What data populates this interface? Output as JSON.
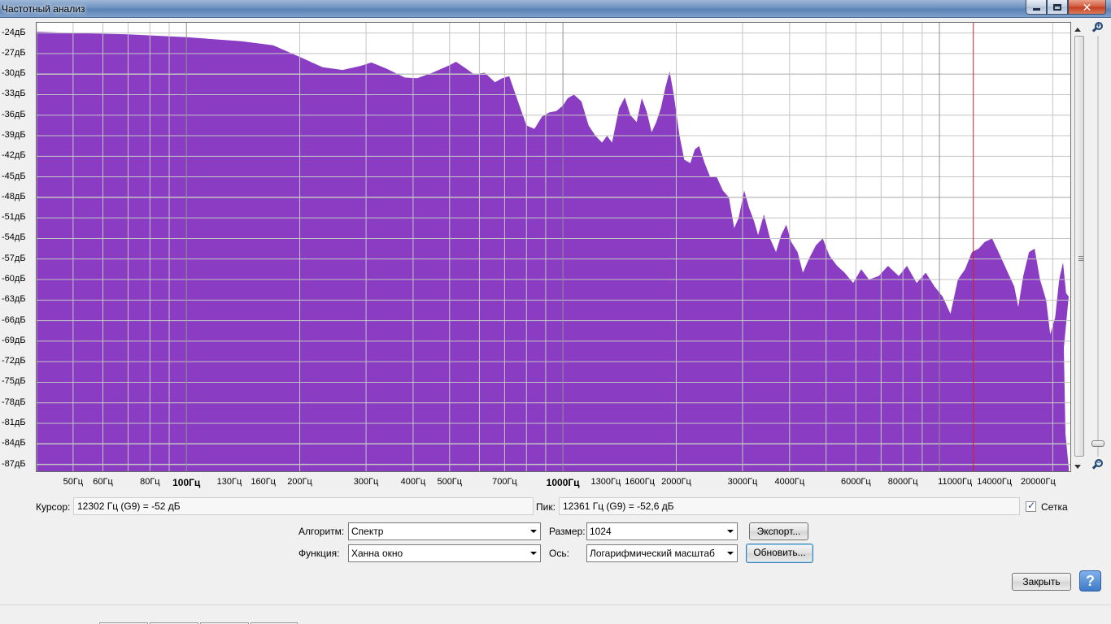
{
  "window": {
    "title": "Частотный анализ"
  },
  "plot": {
    "y_axis_labels": [
      "-24дБ",
      "-27дБ",
      "-30дБ",
      "-33дБ",
      "-36дБ",
      "-39дБ",
      "-42дБ",
      "-45дБ",
      "-48дБ",
      "-51дБ",
      "-54дБ",
      "-57дБ",
      "-60дБ",
      "-63дБ",
      "-66дБ",
      "-69дБ",
      "-72дБ",
      "-75дБ",
      "-78дБ",
      "-81дБ",
      "-84дБ",
      "-87дБ"
    ],
    "x_axis_labels": [
      {
        "text": "50Гц",
        "hz": 50
      },
      {
        "text": "60Гц",
        "hz": 60
      },
      {
        "text": "80Гц",
        "hz": 80
      },
      {
        "text": "100Гц",
        "hz": 100,
        "major": true
      },
      {
        "text": "130Гц",
        "hz": 130
      },
      {
        "text": "160Гц",
        "hz": 160
      },
      {
        "text": "200Гц",
        "hz": 200
      },
      {
        "text": "300Гц",
        "hz": 300
      },
      {
        "text": "400Гц",
        "hz": 400
      },
      {
        "text": "500Гц",
        "hz": 500
      },
      {
        "text": "700Гц",
        "hz": 700
      },
      {
        "text": "1000Гц",
        "hz": 1000,
        "major": true
      },
      {
        "text": "1300Гц",
        "hz": 1300
      },
      {
        "text": "1600Гц",
        "hz": 1600
      },
      {
        "text": "2000Гц",
        "hz": 2000
      },
      {
        "text": "3000Гц",
        "hz": 3000
      },
      {
        "text": "4000Гц",
        "hz": 4000
      },
      {
        "text": "6000Гц",
        "hz": 6000
      },
      {
        "text": "8000Гц",
        "hz": 8000
      },
      {
        "text": "11000Гц",
        "hz": 11000
      },
      {
        "text": "14000Гц",
        "hz": 14000
      },
      {
        "text": "20000Гц",
        "hz": 20000
      }
    ],
    "fill_color": "#8a3cc2",
    "cursor_line_color": "#cc2222",
    "grid_color": "#c4c4c4",
    "cursor_hz": 12302,
    "grid": true,
    "x_scale": "log",
    "x_range_hz": [
      40,
      22050
    ],
    "y_range_db": [
      -88,
      -22.5
    ],
    "spectrum_points": [
      [
        40,
        -23.8
      ],
      [
        50,
        -24.0
      ],
      [
        70,
        -24.2
      ],
      [
        100,
        -24.6
      ],
      [
        140,
        -25.2
      ],
      [
        170,
        -25.8
      ],
      [
        200,
        -27.5
      ],
      [
        230,
        -29.0
      ],
      [
        260,
        -29.4
      ],
      [
        290,
        -28.8
      ],
      [
        310,
        -28.3
      ],
      [
        340,
        -29.2
      ],
      [
        380,
        -30.5
      ],
      [
        410,
        -30.6
      ],
      [
        450,
        -29.8
      ],
      [
        500,
        -28.7
      ],
      [
        520,
        -28.2
      ],
      [
        550,
        -29.1
      ],
      [
        580,
        -30.0
      ],
      [
        620,
        -29.8
      ],
      [
        660,
        -31.2
      ],
      [
        690,
        -30.6
      ],
      [
        720,
        -30.3
      ],
      [
        760,
        -34.0
      ],
      [
        800,
        -37.5
      ],
      [
        840,
        -38.0
      ],
      [
        880,
        -36.2
      ],
      [
        920,
        -35.6
      ],
      [
        960,
        -35.4
      ],
      [
        1000,
        -34.6
      ],
      [
        1030,
        -33.5
      ],
      [
        1070,
        -33.0
      ],
      [
        1120,
        -34.0
      ],
      [
        1170,
        -37.5
      ],
      [
        1220,
        -39.0
      ],
      [
        1270,
        -40.0
      ],
      [
        1310,
        -39.0
      ],
      [
        1350,
        -40.0
      ],
      [
        1410,
        -35.0
      ],
      [
        1460,
        -33.4
      ],
      [
        1510,
        -36.0
      ],
      [
        1570,
        -37.0
      ],
      [
        1620,
        -33.5
      ],
      [
        1670,
        -35.5
      ],
      [
        1720,
        -38.5
      ],
      [
        1770,
        -37.0
      ],
      [
        1820,
        -35.0
      ],
      [
        1870,
        -32.0
      ],
      [
        1920,
        -29.6
      ],
      [
        1970,
        -33.0
      ],
      [
        2040,
        -39.0
      ],
      [
        2100,
        -42.5
      ],
      [
        2180,
        -43.0
      ],
      [
        2240,
        -41.0
      ],
      [
        2300,
        -40.5
      ],
      [
        2380,
        -43.0
      ],
      [
        2460,
        -45.0
      ],
      [
        2560,
        -45.0
      ],
      [
        2660,
        -47.0
      ],
      [
        2760,
        -48.0
      ],
      [
        2850,
        -52.5
      ],
      [
        2930,
        -51.0
      ],
      [
        3030,
        -47.0
      ],
      [
        3120,
        -49.5
      ],
      [
        3220,
        -51.5
      ],
      [
        3300,
        -53.5
      ],
      [
        3420,
        -50.5
      ],
      [
        3550,
        -54.0
      ],
      [
        3680,
        -56.0
      ],
      [
        3800,
        -53.5
      ],
      [
        3920,
        -52.0
      ],
      [
        4040,
        -54.5
      ],
      [
        4200,
        -56.0
      ],
      [
        4340,
        -59.0
      ],
      [
        4500,
        -57.0
      ],
      [
        4700,
        -55.0
      ],
      [
        4900,
        -54.0
      ],
      [
        5100,
        -56.5
      ],
      [
        5350,
        -58.0
      ],
      [
        5600,
        -59.0
      ],
      [
        5900,
        -60.5
      ],
      [
        6200,
        -58.5
      ],
      [
        6500,
        -60.0
      ],
      [
        6900,
        -59.5
      ],
      [
        7300,
        -58.0
      ],
      [
        7800,
        -59.5
      ],
      [
        8200,
        -58.0
      ],
      [
        8700,
        -60.5
      ],
      [
        9200,
        -59.0
      ],
      [
        9700,
        -61.0
      ],
      [
        10200,
        -62.5
      ],
      [
        10700,
        -65.0
      ],
      [
        11200,
        -60.0
      ],
      [
        11700,
        -58.5
      ],
      [
        12200,
        -56.0
      ],
      [
        12700,
        -55.5
      ],
      [
        13200,
        -54.5
      ],
      [
        13800,
        -54.0
      ],
      [
        14500,
        -56.5
      ],
      [
        15200,
        -59.0
      ],
      [
        15800,
        -61.0
      ],
      [
        16200,
        -64.0
      ],
      [
        16700,
        -59.5
      ],
      [
        17300,
        -56.0
      ],
      [
        17900,
        -55.5
      ],
      [
        18500,
        -60.0
      ],
      [
        19200,
        -63.0
      ],
      [
        19700,
        -68.0
      ],
      [
        20300,
        -65.5
      ],
      [
        20800,
        -60.0
      ],
      [
        21300,
        -57.5
      ],
      [
        21700,
        -62.0
      ],
      [
        22050,
        -62.5
      ]
    ],
    "spectrum_tail": [
      [
        22050,
        -70.0
      ],
      [
        22050,
        -82.5
      ],
      [
        22050,
        -85.0
      ],
      [
        22050,
        -87.5
      ]
    ]
  },
  "controls": {
    "cursor_label": "Курсор:",
    "cursor_value": "12302 Гц (G9) = -52 дБ",
    "peak_label": "Пик:",
    "peak_value": "12361 Гц (G9) = -52,6 дБ",
    "grid_label": "Сетка",
    "grid_checked": true,
    "algorithm_label": "Алгоритм:",
    "algorithm_value": "Спектр",
    "function_label": "Функция:",
    "function_value": "Ханна  окно",
    "size_label": "Размер:",
    "size_value": "1024",
    "axis_label": "Ось:",
    "axis_value": "Логарифмический масштаб",
    "export_button": "Экспорт...",
    "refresh_button": "Обновить...",
    "close_button": "Закрыть",
    "help_button": "?"
  },
  "icons": {
    "zoom_in": "zoom-in-icon",
    "zoom_out": "zoom-out-icon",
    "minimize": "minimize-icon",
    "maximize": "maximize-icon",
    "close": "close-icon",
    "help": "help-icon"
  }
}
